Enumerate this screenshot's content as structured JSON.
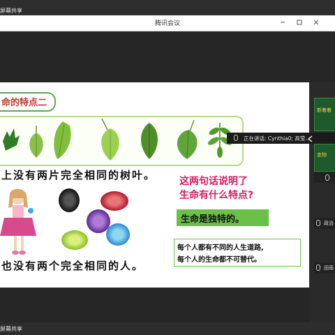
{
  "top": {
    "share_label": "屏幕共享",
    "share_bar_percent": 50
  },
  "window": {
    "title": "腾讯会议"
  },
  "slide": {
    "title": "命的特点二",
    "line1": "上没有两片完全相同的树叶。",
    "line2": "也没有两个完全相同的人。",
    "question": [
      "这两句话说明了",
      "生命有什么特点?"
    ],
    "answer": "生命是独特的。",
    "note": [
      "每个人都有不同的人生道路,",
      "每个人的生命都不可替代。"
    ]
  },
  "speaker": {
    "label": "正在讲话: Cynthia0; 高莹..."
  },
  "sidebar": {
    "participants": [
      {
        "name": "政治"
      },
      {
        "name": "田雨"
      }
    ],
    "thumb_top": "新着着",
    "thumb_bottom": "忠物"
  },
  "bottom": {
    "share_label": "屏幕共享"
  },
  "colors": {
    "accent_green": "#6cc04a",
    "question_pink": "#d81b60",
    "title_red": "#c0392b"
  }
}
